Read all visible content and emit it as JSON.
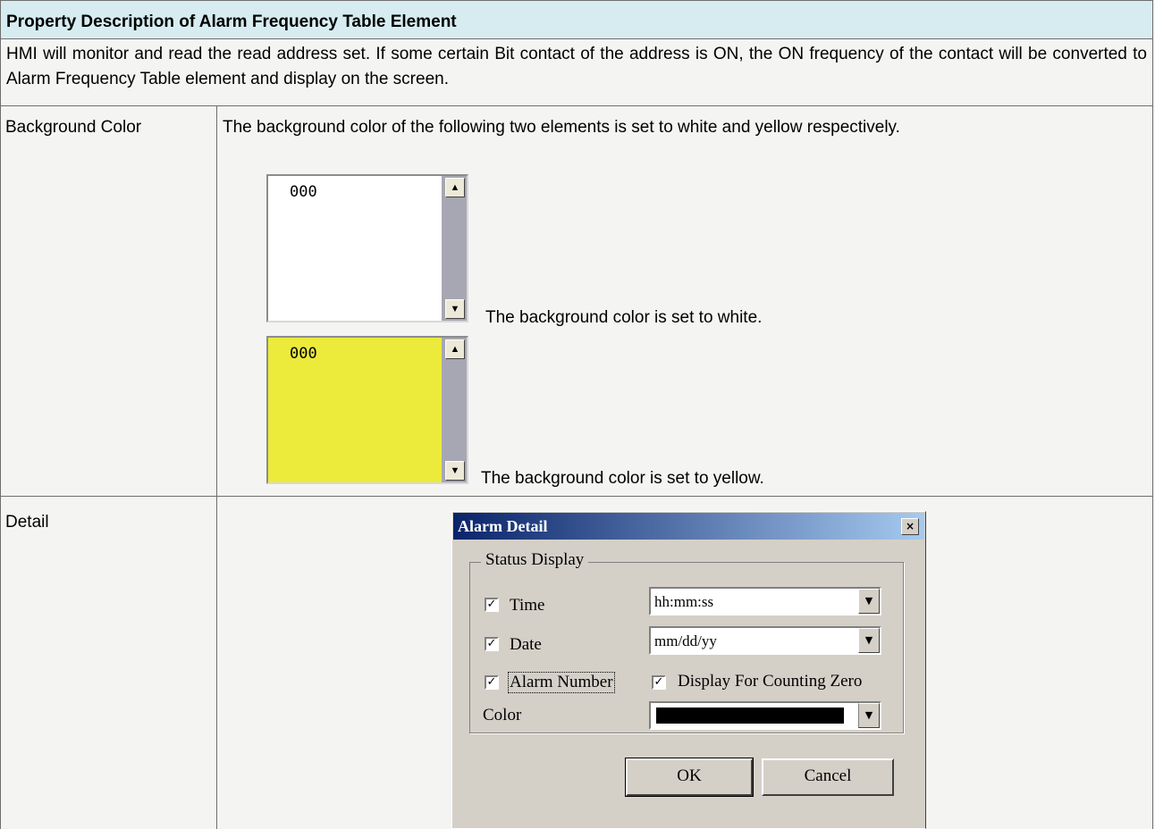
{
  "header": {
    "title": "Property Description of Alarm Frequency Table Element"
  },
  "intro": "HMI will monitor and read the read address set. If some certain Bit contact of the address is ON, the ON frequency of the contact will be converted to Alarm Frequency Table element and display on the screen.",
  "background_color": {
    "label": "Background Color",
    "description": "The background color of the following two elements is set to white and yellow respectively.",
    "examples": [
      {
        "value": "000",
        "fill": "#ffffff",
        "caption": "The background color is set to white."
      },
      {
        "value": "000",
        "fill": "#ecea3b",
        "caption": "The background color is set to yellow."
      }
    ]
  },
  "detail": {
    "label": "Detail",
    "dialog": {
      "title": "Alarm Detail",
      "group_title": "Status Display",
      "time_label": "Time",
      "time_format": "hh:mm:ss",
      "date_label": "Date",
      "date_format": "mm/dd/yy",
      "alarm_number_label": "Alarm Number",
      "counting_zero_label": "Display For Counting Zero",
      "color_label": "Color",
      "color_value": "#000000",
      "ok_label": "OK",
      "cancel_label": "Cancel"
    }
  }
}
